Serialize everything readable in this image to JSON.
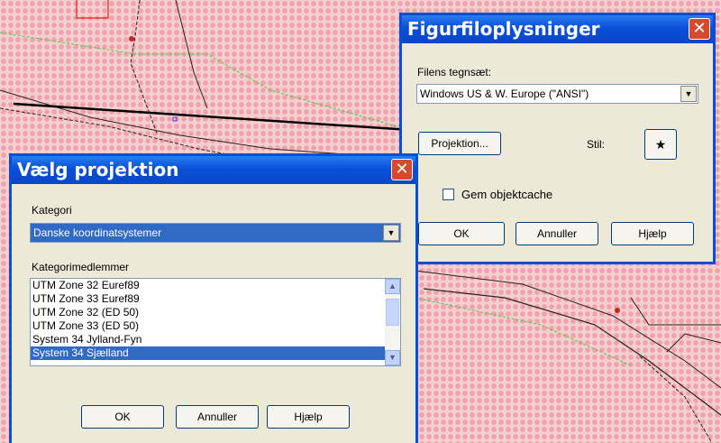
{
  "proj_dialog": {
    "title": "Vælg projektion",
    "close_glyph": "✕",
    "category_label": "Kategori",
    "category_value": "Danske koordinatsystemer",
    "members_label": "Kategorimedlemmer",
    "members": [
      "UTM Zone 32 Euref89",
      "UTM Zone 33 Euref89",
      "UTM Zone 32 (ED 50)",
      "UTM Zone 33 (ED 50)",
      "System 34 Jylland-Fyn",
      "System 34 Sjælland"
    ],
    "selected_member": "System 34 Sjælland",
    "ok": "OK",
    "cancel": "Annuller",
    "help": "Hjælp"
  },
  "file_dialog": {
    "title": "Figurfiloplysninger",
    "close_glyph": "✕",
    "charset_label": "Filens tegnsæt:",
    "charset_value": "Windows US & W. Europe (\"ANSI\")",
    "projection_button": "Projektion...",
    "style_label": "Stil:",
    "style_symbol": "★",
    "cache_label": "Gem objektcache",
    "ok": "OK",
    "cancel": "Annuller",
    "help": "Hjælp"
  },
  "icons": {
    "dropdown_arrow": "▼",
    "scroll_up": "▲",
    "scroll_down": "▼"
  }
}
